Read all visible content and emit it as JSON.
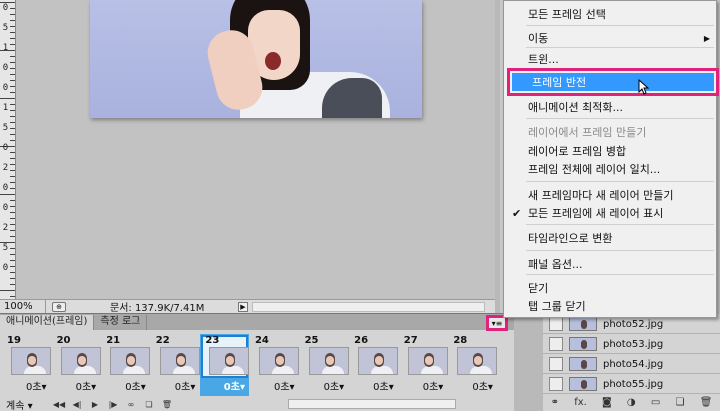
{
  "ruler": {
    "labels": [
      "0",
      "5",
      "1",
      "0",
      "0",
      "1",
      "5",
      "0",
      "2",
      "0",
      "0",
      "2",
      "5",
      "0"
    ]
  },
  "status": {
    "zoom": "100%",
    "doc_info": "문서: 137.9K/7.41M"
  },
  "animation_panel": {
    "tabs": [
      {
        "label": "애니메이션(프레임)",
        "active": true
      },
      {
        "label": "측정 로그",
        "active": false
      }
    ],
    "frames": [
      {
        "num": "19",
        "delay": "0초▾",
        "selected": false
      },
      {
        "num": "20",
        "delay": "0초▾",
        "selected": false
      },
      {
        "num": "21",
        "delay": "0초▾",
        "selected": false
      },
      {
        "num": "22",
        "delay": "0초▾",
        "selected": false
      },
      {
        "num": "23",
        "delay": "0초▾",
        "selected": true
      },
      {
        "num": "24",
        "delay": "0초▾",
        "selected": false
      },
      {
        "num": "25",
        "delay": "0초▾",
        "selected": false
      },
      {
        "num": "26",
        "delay": "0초▾",
        "selected": false
      },
      {
        "num": "27",
        "delay": "0초▾",
        "selected": false
      },
      {
        "num": "28",
        "delay": "0초▾",
        "selected": false
      }
    ],
    "loop": "계속 ▾"
  },
  "layers_panel": {
    "layers": [
      {
        "name": "photo52.jpg"
      },
      {
        "name": "photo53.jpg"
      },
      {
        "name": "photo54.jpg"
      },
      {
        "name": "photo55.jpg"
      }
    ],
    "footer_fx": "fx."
  },
  "context_menu": {
    "items": [
      {
        "label": "모든 프레임 선택",
        "disabled": false,
        "check": "",
        "submenu": ""
      },
      {
        "label": "이동",
        "disabled": false,
        "check": "",
        "submenu": "▶"
      },
      {
        "label": "트윈...",
        "disabled": false,
        "check": "",
        "submenu": ""
      },
      {
        "label": "프레임 반전",
        "disabled": false,
        "check": "",
        "submenu": "",
        "highlighted": true
      },
      {
        "label": "애니메이션 최적화...",
        "disabled": false,
        "check": "",
        "submenu": ""
      },
      {
        "label": "레이어에서 프레임 만들기",
        "disabled": true,
        "check": "",
        "submenu": ""
      },
      {
        "label": "레이어로 프레임 병합",
        "disabled": false,
        "check": "",
        "submenu": ""
      },
      {
        "label": "프레임 전체에 레이어 일치...",
        "disabled": false,
        "check": "",
        "submenu": ""
      },
      {
        "label": "새 프레임마다 새 레이어 만들기",
        "disabled": false,
        "check": "",
        "submenu": ""
      },
      {
        "label": "모든 프레임에 새 레이어 표시",
        "disabled": false,
        "check": "✔",
        "submenu": ""
      },
      {
        "label": "타임라인으로 변환",
        "disabled": false,
        "check": "",
        "submenu": ""
      },
      {
        "label": "패널 옵션...",
        "disabled": false,
        "check": "",
        "submenu": ""
      },
      {
        "label": "닫기",
        "disabled": false,
        "check": "",
        "submenu": ""
      },
      {
        "label": "탭 그룹 닫기",
        "disabled": false,
        "check": "",
        "submenu": ""
      }
    ]
  }
}
